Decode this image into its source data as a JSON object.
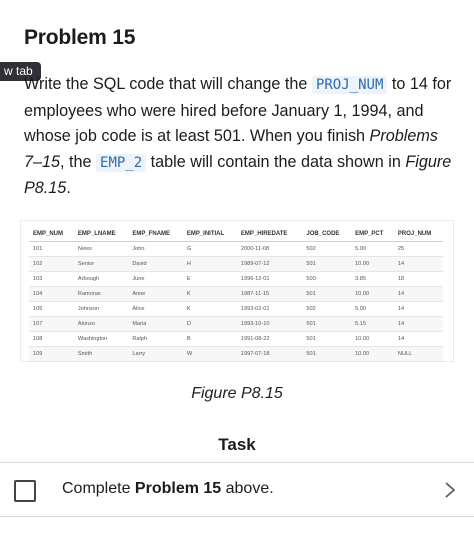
{
  "title": "Problem 15",
  "new_tab_label": "w tab",
  "problem": {
    "t1": "Write the SQL code that will change the ",
    "code1": "PROJ_NUM",
    "t2": " to 14 for employees who were hired before January 1, 1994, and whose job code is at least 501. When you finish ",
    "em1": "Problems 7–15",
    "t3": ", the ",
    "code2": "EMP_2",
    "t4": " table will contain the data shown in ",
    "em2": "Figure P8.15",
    "t5": "."
  },
  "table": {
    "columns": [
      "EMP_NUM",
      "EMP_LNAME",
      "EMP_FNAME",
      "EMP_INITIAL",
      "EMP_HIREDATE",
      "JOB_CODE",
      "EMP_PCT",
      "PROJ_NUM"
    ],
    "rows": [
      [
        "101",
        "News",
        "John",
        "G",
        "2000-11-08",
        "502",
        "5.00",
        "25"
      ],
      [
        "102",
        "Senior",
        "David",
        "H",
        "1989-07-12",
        "501",
        "10.00",
        "14"
      ],
      [
        "103",
        "Arbough",
        "June",
        "E",
        "1996-12-01",
        "500",
        "3.85",
        "18"
      ],
      [
        "104",
        "Ramoras",
        "Anne",
        "K",
        "1987-11-15",
        "501",
        "10.00",
        "14"
      ],
      [
        "105",
        "Johnson",
        "Alice",
        "K",
        "1993-02-01",
        "502",
        "5.00",
        "14"
      ],
      [
        "107",
        "Alonzo",
        "Maria",
        "D",
        "1993-10-10",
        "501",
        "5.15",
        "14"
      ],
      [
        "108",
        "Washington",
        "Ralph",
        "B",
        "1991-08-22",
        "501",
        "10.00",
        "14"
      ],
      [
        "109",
        "Smith",
        "Larry",
        "W",
        "1997-07-18",
        "501",
        "10.00",
        "NULL"
      ]
    ]
  },
  "figure_caption": "Figure P8.15",
  "task": {
    "heading": "Task",
    "prefix": "Complete ",
    "bold": "Problem 15",
    "suffix": " above."
  }
}
